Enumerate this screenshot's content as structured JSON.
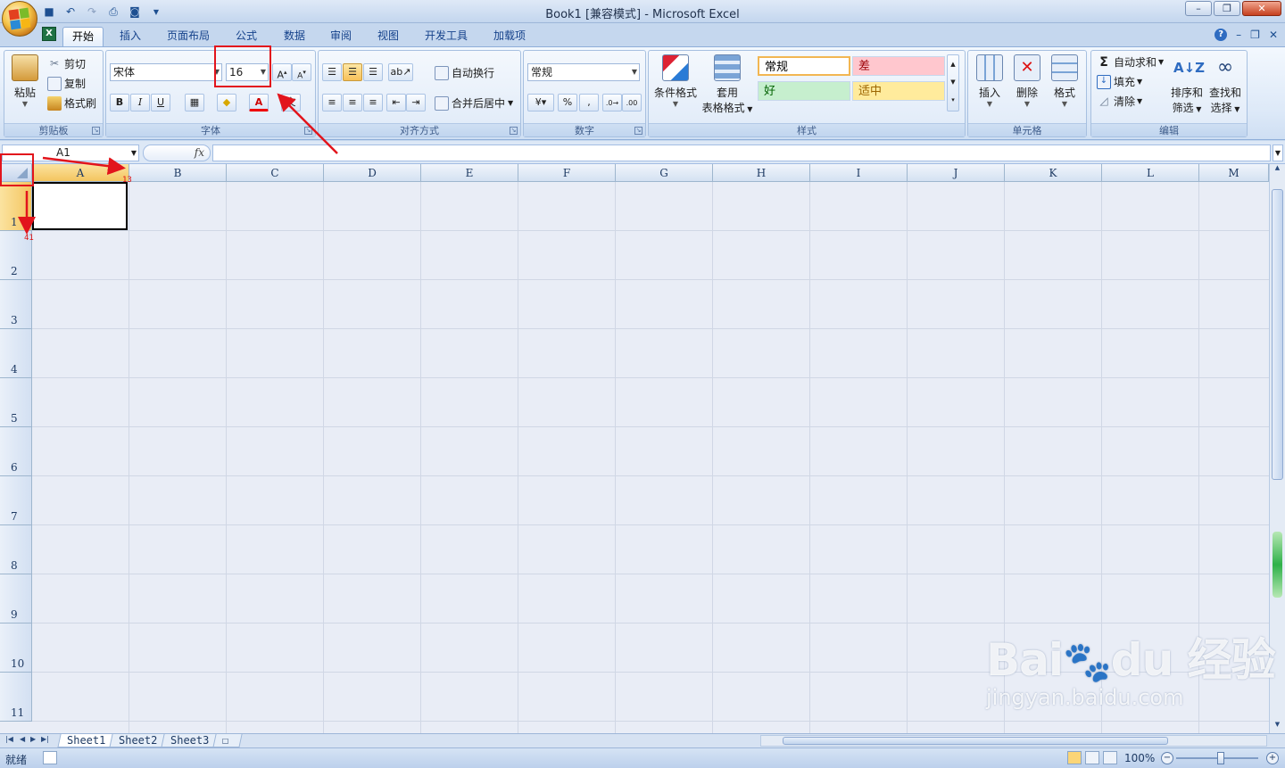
{
  "window": {
    "title": "Book1  [兼容模式] - Microsoft Excel",
    "controls": [
      "minimize",
      "restore",
      "close"
    ]
  },
  "quick_access": [
    "save-icon",
    "undo-icon",
    "redo-icon",
    "print-preview-icon",
    "camera-icon",
    "customize-icon"
  ],
  "tabs": [
    "开始",
    "插入",
    "页面布局",
    "公式",
    "数据",
    "审阅",
    "视图",
    "开发工具",
    "加载项"
  ],
  "active_tab": "开始",
  "ribbon": {
    "clipboard": {
      "label": "剪贴板",
      "paste": "粘贴",
      "cut": "剪切",
      "copy": "复制",
      "format_painter": "格式刷"
    },
    "font": {
      "label": "字体",
      "font_name": "宋体",
      "font_size": "16",
      "bold": "B",
      "italic": "I",
      "underline": "U",
      "grow": "A",
      "shrink": "A",
      "color_letter": "A"
    },
    "alignment": {
      "label": "对齐方式",
      "wrap": "自动换行",
      "merge": "合并后居中"
    },
    "number": {
      "label": "数字",
      "format": "常规",
      "percent": "%",
      "comma": ","
    },
    "styles": {
      "label": "样式",
      "conditional": "条件格式",
      "table_format_1": "套用",
      "table_format_2": "表格格式",
      "cells": [
        {
          "text": "常规",
          "bg": "#ffffff",
          "color": "#000000"
        },
        {
          "text": "差",
          "bg": "#ffc7ce",
          "color": "#9c0006"
        },
        {
          "text": "好",
          "bg": "#c6efce",
          "color": "#006100"
        },
        {
          "text": "适中",
          "bg": "#ffeb9c",
          "color": "#9c6500"
        }
      ]
    },
    "cells": {
      "label": "单元格",
      "insert": "插入",
      "delete": "删除",
      "format": "格式"
    },
    "editing": {
      "label": "编辑",
      "autosum": "自动求和",
      "fill": "填充",
      "clear": "清除",
      "sort_1": "排序和",
      "sort_2": "筛选",
      "find_1": "查找和",
      "find_2": "选择"
    }
  },
  "formula_bar": {
    "name_box": "A1",
    "fx": "fx",
    "value": ""
  },
  "columns": [
    "A",
    "B",
    "C",
    "D",
    "E",
    "F",
    "G",
    "H",
    "I",
    "J",
    "K",
    "L",
    "M"
  ],
  "rows": [
    "1",
    "2",
    "3",
    "4",
    "5",
    "6",
    "7",
    "8",
    "9",
    "10",
    "11"
  ],
  "sheets": [
    "Sheet1",
    "Sheet2",
    "Sheet3"
  ],
  "active_sheet": "Sheet1",
  "status": {
    "text": "就绪",
    "zoom": "100%"
  },
  "annotations": {
    "col_width_label": "13",
    "row_height_label": "41",
    "color": "#e2141c"
  }
}
